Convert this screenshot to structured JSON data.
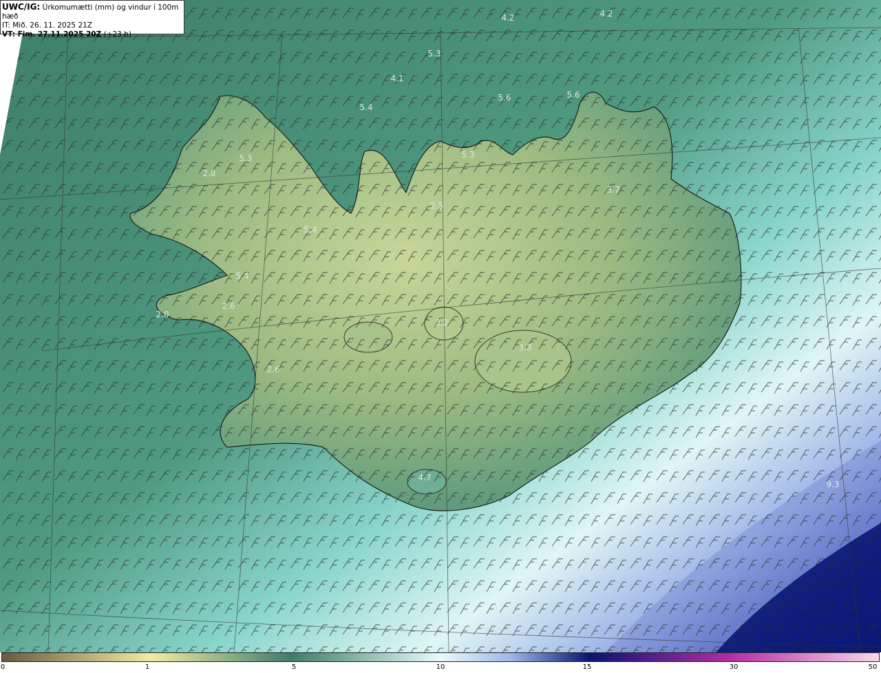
{
  "header": {
    "model": "UWC/IG:",
    "title": "Úrkomumætti (mm) og vindur í 100m hæð",
    "init_time": "IT: Mið. 26. 11. 2025 21Z",
    "valid_prefix": "VT: Fim. 27.11.2025 20Z",
    "valid_suffix": "(+23 h)"
  },
  "colors": {
    "land_light": "#c9d79a",
    "land_mid": "#8fb27e",
    "sea_green": "#4a8a74",
    "sea_teal": "#7fd3c9",
    "pale_cyan": "#d9f4f2",
    "deep_blue": "#0b1a7a",
    "coast": "#141414"
  },
  "colorbar": {
    "ticks": [
      "0",
      "1",
      "5",
      "10",
      "15",
      "30",
      "50"
    ]
  },
  "map_labels": [
    {
      "text": "4.2"
    },
    {
      "text": "4.2"
    },
    {
      "text": "5.3"
    },
    {
      "text": "4.1"
    },
    {
      "text": "5.4"
    },
    {
      "text": "5.6"
    },
    {
      "text": "5.6"
    },
    {
      "text": "5.3"
    },
    {
      "text": "5.3"
    },
    {
      "text": "2.8"
    },
    {
      "text": "2.5"
    },
    {
      "text": "3.7"
    },
    {
      "text": "5.4"
    },
    {
      "text": "5.4"
    },
    {
      "text": "2.6"
    },
    {
      "text": "2.0"
    },
    {
      "text": "3.2"
    },
    {
      "text": "3.3"
    },
    {
      "text": "2.6"
    },
    {
      "text": "4.7"
    },
    {
      "text": "9.3"
    }
  ]
}
